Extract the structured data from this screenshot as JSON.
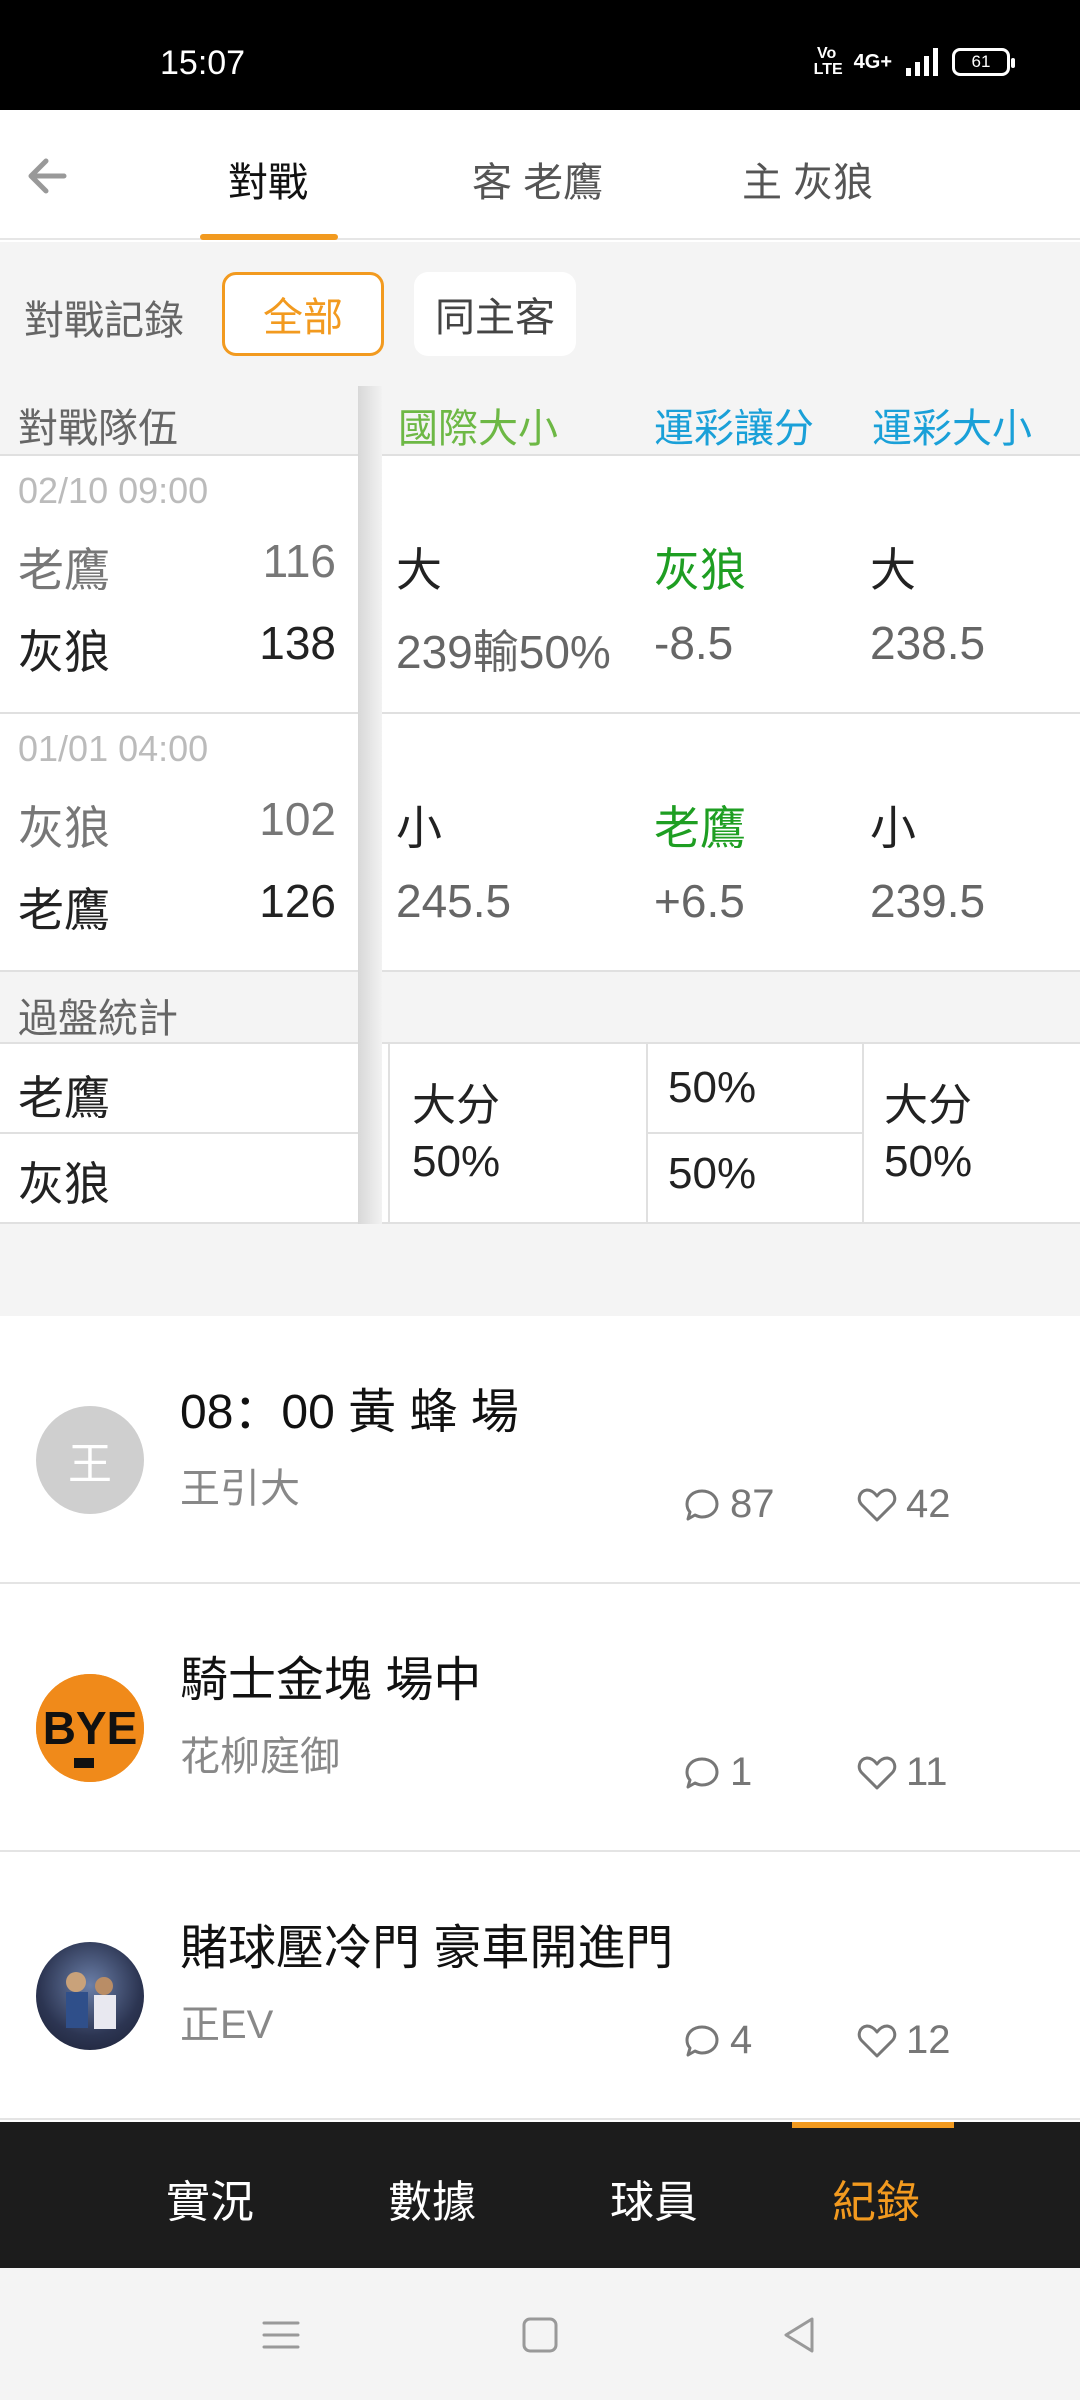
{
  "status_bar": {
    "time": "15:07",
    "volte": "Vo LTE",
    "network": "4G+",
    "battery": "61"
  },
  "header": {
    "tabs": [
      {
        "label": "對戰"
      },
      {
        "label": "客 老鷹"
      },
      {
        "label": "主 灰狼"
      }
    ]
  },
  "filter": {
    "label": "對戰記錄",
    "options": [
      "全部",
      "同主客"
    ]
  },
  "table": {
    "columns": [
      "對戰隊伍",
      "國際大小",
      "運彩讓分",
      "運彩大小"
    ],
    "matches": [
      {
        "date": "02/10 09:00",
        "away_team": "老鷹",
        "away_score": "116",
        "home_team": "灰狼",
        "home_score": "138",
        "intl_result": "大",
        "intl_line": "239輸50%",
        "spread_team": "灰狼",
        "spread_line": "-8.5",
        "ou_result": "大",
        "ou_line": "238.5"
      },
      {
        "date": "01/01 04:00",
        "away_team": "灰狼",
        "away_score": "102",
        "home_team": "老鷹",
        "home_score": "126",
        "intl_result": "小",
        "intl_line": "245.5",
        "spread_team": "老鷹",
        "spread_line": "+6.5",
        "ou_result": "小",
        "ou_line": "239.5"
      }
    ],
    "stats": {
      "label": "過盤統計",
      "teams": [
        "老鷹",
        "灰狼"
      ],
      "intl": {
        "label": "大分",
        "pct": "50%"
      },
      "spread": [
        "50%",
        "50%"
      ],
      "ou": {
        "label": "大分",
        "pct": "50%"
      }
    }
  },
  "posts": [
    {
      "avatar_text": "王",
      "title": "08：00 黃 蜂 場",
      "author": "王引大",
      "comments": "87",
      "likes": "42"
    },
    {
      "avatar_text": "BYE",
      "title": "騎士金塊 場中",
      "author": "花柳庭御",
      "comments": "1",
      "likes": "11"
    },
    {
      "avatar_text": "",
      "title": "賭球壓冷門 豪車開進門",
      "author": "正EV",
      "comments": "4",
      "likes": "12"
    }
  ],
  "bottom_tabs": [
    "實況",
    "數據",
    "球員",
    "紀錄"
  ],
  "colors": {
    "accent": "#f29a1f",
    "intl_header": "#6db845",
    "spread_header": "#1aa0d8",
    "green_team": "#1e9e22"
  }
}
